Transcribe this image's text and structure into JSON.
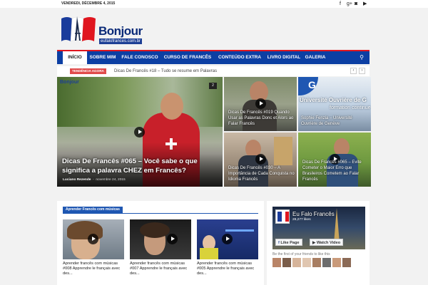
{
  "topbar": {
    "date": "VENDREDI, DÉCEMBRE 4, 2015",
    "social_icons": [
      "facebook-icon",
      "google-plus-icon",
      "instagram-icon",
      "youtube-icon"
    ]
  },
  "logo": {
    "title": "Bonjour",
    "subtitle": "eufalofrances.com.br",
    "accent_colors": [
      "#0a2a78",
      "#e0161f"
    ]
  },
  "nav": {
    "items": [
      "INÍCIO",
      "SOBRE MIM",
      "FALE CONOSCO",
      "CURSO DE FRANCÊS",
      "CONTEÚDO EXTRA",
      "LIVRO DIGITAL",
      "GALERIA"
    ],
    "active_index": 0,
    "bg_color": "#0c3fa3"
  },
  "trending": {
    "badge": "TENDÊNCIA AGORA",
    "text": "Dicas De Francês #18 – Tudo se resume em Palavras"
  },
  "featured": {
    "main": {
      "title": "Dicas De Francês #065 – Você sabe o que significa a palavra CHEZ em Francês?",
      "author": "Luciano Rezende",
      "date": "novembre 24, 2015",
      "count": "2",
      "logo_text": "Bonjour"
    },
    "side": [
      {
        "title": "Dicas De Francês #019 Quando Usar as Palavras Donc et Alors ao Falar Francês"
      },
      {
        "title": "Sophie Fenzia – Université Ouvrière de Genève",
        "overlay": "Université Ouvrière de G",
        "overlay2": "formation continue"
      },
      {
        "title": "Dicas De Francês #030 – A Importância de Cada Conquista no Idioma Francês"
      },
      {
        "title": "Dicas De Francês #065 – Evite Cometer o Maior Erro que Brasileiros Cometem ao Falar Francês"
      }
    ]
  },
  "music_section": {
    "header": "Aprender Francês com músicas",
    "cards": [
      {
        "title": "Aprender francês com músicas #008 Apprendre le français avec des..."
      },
      {
        "title": "Aprender francês com músicas #007 Apprendre le français avec des..."
      },
      {
        "title": "Aprender francês com músicas #005 Apprendre le français avec des..."
      }
    ]
  },
  "facebook": {
    "page_name": "Eu Falo Francês",
    "likes": "28,277 likes",
    "like_button": "Like Page",
    "watch_button": "Watch Video",
    "friends_text": "Be the first of your friends to like this"
  }
}
